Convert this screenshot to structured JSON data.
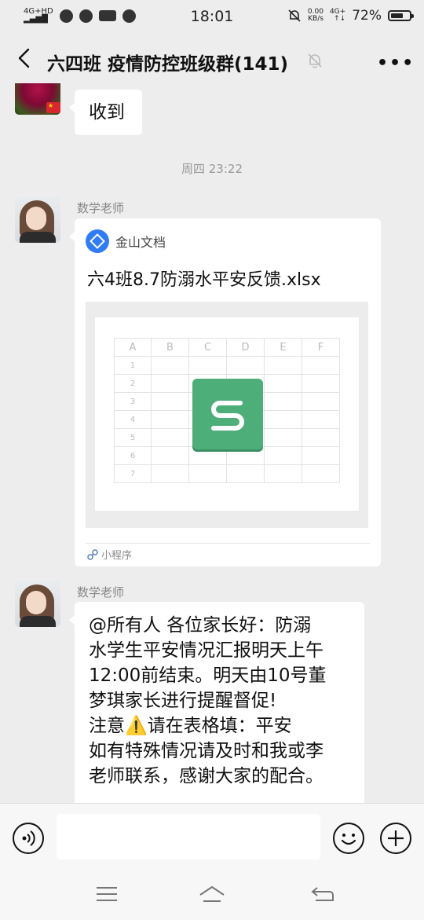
{
  "status_bar": {
    "signal": "4G+HD",
    "time": "18:01",
    "net_speed_value": "0.00",
    "net_speed_unit": "KB/s",
    "network": "4G+",
    "battery_percent": "72%",
    "battery_level": 0.72
  },
  "header": {
    "title": "六四班 疫情防控班级群(141)"
  },
  "messages": [
    {
      "type": "text",
      "text": "收到"
    },
    {
      "type": "time",
      "text": "周四 23:22"
    },
    {
      "type": "card",
      "sender": "数学老师",
      "app_name": "金山文档",
      "file_name": "六4班8.7防溺水平安反馈.xlsx",
      "columns": [
        "A",
        "B",
        "C",
        "D",
        "E",
        "F"
      ],
      "rows": [
        "1",
        "2",
        "3",
        "4",
        "5",
        "6",
        "7"
      ],
      "footer": "小程序"
    },
    {
      "type": "text",
      "sender": "数学老师",
      "lines": [
        "@所有人 各位家长好：防溺",
        "水学生平安情况汇报明天上午",
        "12:00前结束。明天由10号董",
        "梦琪家长进行提醒督促!",
        "注意⚠️请在表格填：平安",
        "如有特殊情况请及时和我或李",
        "老师联系，感谢大家的配合。"
      ]
    }
  ]
}
